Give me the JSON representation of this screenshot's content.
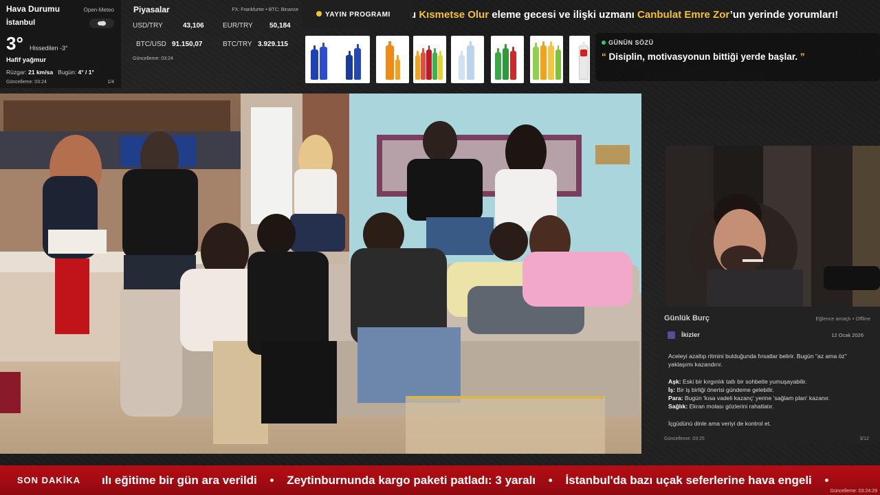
{
  "weather": {
    "title": "Hava Durumu",
    "source": "Open-Meteo",
    "city": "İstanbul",
    "temperature": "3°",
    "feels_like": "Hissedilen -3°",
    "condition": "Hafif yağmur",
    "wind_label": "Rüzgar:",
    "wind_value": "21 km/sa",
    "today_label": "Bugün:",
    "today_value": "4° / 1°",
    "updated": "Güncelleme: 03:24",
    "page": "1/4",
    "icon": "cloud-rain-icon"
  },
  "markets": {
    "title": "Piyasalar",
    "source": "FX: Frankfurter • BTC: Binance",
    "rows": [
      {
        "pair": "USD/TRY",
        "value": "43,106"
      },
      {
        "pair": "EUR/TRY",
        "value": "50,184"
      },
      {
        "pair": "BTC/USD",
        "value": "91.150,07"
      },
      {
        "pair": "BTC/TRY",
        "value": "3.929.115"
      }
    ],
    "updated": "Güncelleme: 03:24"
  },
  "program": {
    "label": "YAYIN PROGRAMI"
  },
  "top_ticker": {
    "part1": "u ",
    "highlight1": "Kısmetse Olur",
    "part2": " eleme gecesi ve ilişki uzmanı ",
    "highlight2": "Canbulat Emre Zor",
    "part3": "’un yerinde yorumları!"
  },
  "ads": {
    "tiles": [
      "energy-cans",
      "blue-bottle",
      "orange-soda",
      "soda-assortment",
      "water-bottles",
      "green-soda",
      "fruit-sodas",
      "red-label-bottle"
    ]
  },
  "quote": {
    "label": "GÜNÜN SÖZÜ",
    "open_quote": "“",
    "text": "Disiplin, motivasyonun bittiği yerde başlar.",
    "close_quote": "”"
  },
  "horoscope": {
    "title": "Günlük Burç",
    "note": "Eğlence amaçlı • Offline",
    "sign": "İkizler",
    "date": "12 Ocak 2026",
    "intro": "Aceleyi azaltıp ritmini bulduğunda fırsatlar belirir. Bugün \"az ama öz\" yaklaşımı kazandırır.",
    "love_label": "Aşk:",
    "love": "Eski bir kırgınlık tatlı bir sohbetle yumuşayabilir.",
    "work_label": "İş:",
    "work": "Bir iş birliği önerisi gündeme gelebilir.",
    "money_label": "Para:",
    "money": "Bugün 'kısa vadeli kazanç' yerine 'sağlam plan' kazanır.",
    "health_label": "Sağlık:",
    "health": "Ekran molası gözlerini rahatlatır.",
    "advice": "İçgüdünü dinle ama veriyi de kontrol et.",
    "updated": "Güncelleme: 03:25",
    "page": "3/12"
  },
  "news": {
    "label": "SON DAKİKA",
    "items": [
      "ılı eğitime bir gün ara verildi",
      "Zeytinburnunda kargo paketi patladı: 3 yaralı",
      "İstanbul'da bazı uçak seferlerine hava engeli"
    ],
    "separator": "•",
    "clock": "Güncelleme: 03:24:29"
  },
  "colors": {
    "accent": "#f2c232",
    "news_red": "#b60d14",
    "live_green": "#2ecc71"
  }
}
